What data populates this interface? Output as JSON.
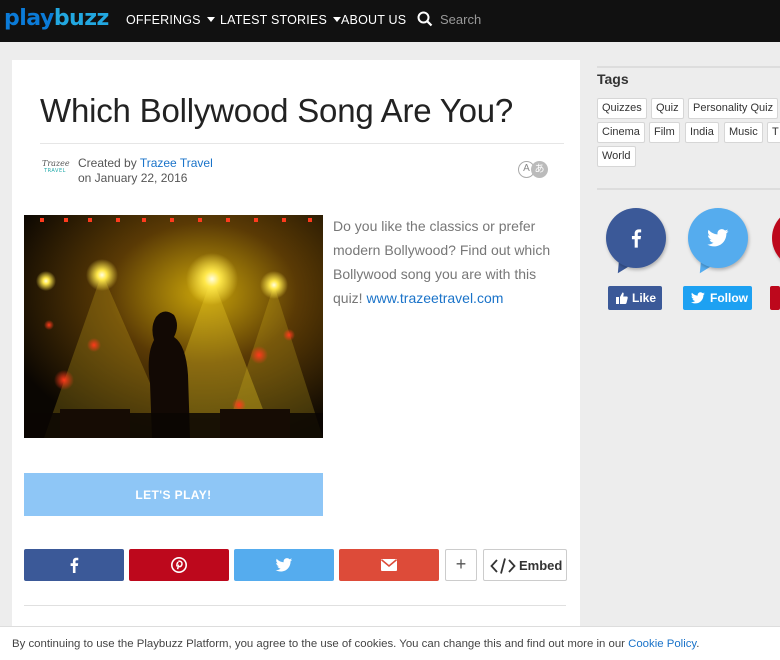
{
  "nav": {
    "logo_a": "play",
    "logo_b": "buzz",
    "offerings": "OFFERINGS",
    "latest_stories": "LATEST STORIES",
    "about_us": "ABOUT US",
    "search_placeholder": "Search"
  },
  "article": {
    "title": "Which Bollywood Song Are You?",
    "author_logo_top": "Trazee",
    "author_logo_bottom": "TRAVEL",
    "created_by_label": "Created by",
    "author": "Trazee Travel",
    "date": "on January 22, 2016",
    "lang_a": "A",
    "lang_j": "あ",
    "description_text": "Do you like the classics or prefer modern Bollywood? Find out which Bollywood song you are with this quiz!",
    "description_link": "www.trazeetravel.com",
    "play_label": "LET'S PLAY!",
    "plus_label": "+",
    "embed_label": "Embed"
  },
  "share_buttons": [
    {
      "name": "facebook",
      "color": "#3b5998"
    },
    {
      "name": "pinterest",
      "color": "#bd081c"
    },
    {
      "name": "twitter",
      "color": "#55acee"
    },
    {
      "name": "email",
      "color": "#dd4b39"
    }
  ],
  "sidebar": {
    "tags_title": "Tags",
    "tags": [
      "Quizzes",
      "Quiz",
      "Personality Quiz",
      "Cinema",
      "Film",
      "India",
      "Music",
      "T",
      "World"
    ],
    "facebook_like": "Like",
    "twitter_follow": "Follow",
    "colors": {
      "facebook": "#3b5998",
      "twitter": "#55acee",
      "third": "#bd081c"
    }
  },
  "cookie": {
    "text": "By continuing to use the Playbuzz Platform, you agree to the use of cookies. You can change this and find out more in our",
    "link": "Cookie Policy",
    "end": "."
  }
}
